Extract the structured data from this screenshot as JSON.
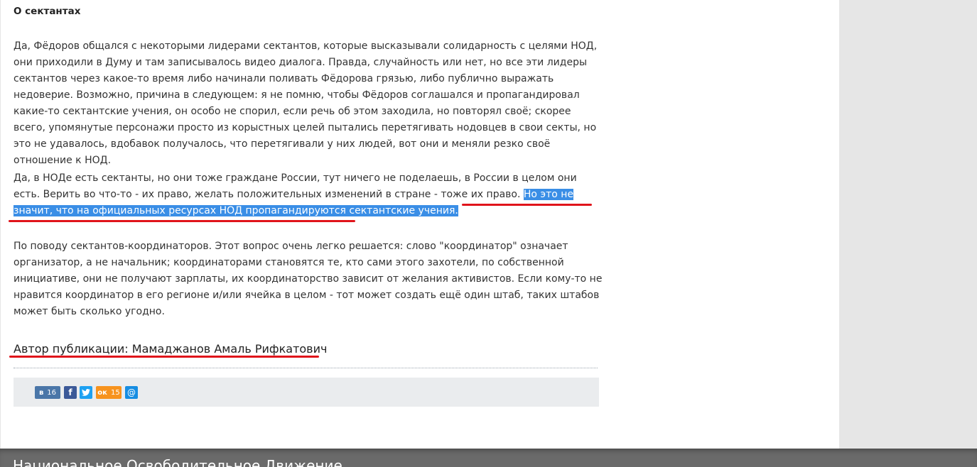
{
  "section_title": "О сектантах",
  "paragraphs": {
    "p1": "Да, Фёдоров общался с некоторыми лидерами сектантов, которые высказывали солидарность с целями НОД, они приходили в Думу и там записывалось видео диалога. Правда, случайность или нет, но все эти лидеры сектантов через какое-то время либо начинали поливать Фёдорова грязью, либо публично выражать недоверие. Возможно, причина в следующем: я не помню, чтобы Фёдоров соглашался и пропагандировал какие-то сектантские учения, он особо не спорил, если речь об этом заходила, но повторял своё; скорее всего, упомянутые персонажи просто из корыстных целей пытались перетягивать нодовцев в свои секты, но это не удавалось, вдобавок получалось, что перетягивали у них людей, вот они и меняли резко своё отношение к НОД.",
    "p2_normal": "Да, в НОДе есть сектанты, но они тоже граждане России, тут ничего не поделаешь, в России в целом они есть. Верить во что-то - их право, желать положительных изменений в стране - тоже их право. ",
    "p2_highlight": "Но это не значит, что на официальных ресурсах НОД пропагандируются сектантские учения.",
    "p3": "По поводу сектантов-координаторов. Этот вопрос очень легко решается: слово \"координатор\" означает организатор, а не начальник; координаторами становятся те, кто сами этого захотели, по собственной инициативе, они не получают зарплаты, их координаторство зависит от желания активистов. Если кому-то не нравится координатор в его регионе и/или ячейка в целом - тот может создать ещё один штаб, таких штабов может быть сколько угодно."
  },
  "author": "Автор публикации: Мамаджанов Амаль Рифкатович",
  "share": {
    "vk": {
      "icon": "в",
      "count": "16"
    },
    "fb": {
      "icon": "f"
    },
    "tw": {
      "icon": "🐦"
    },
    "ok": {
      "icon": "ок",
      "count": "15"
    },
    "mail": {
      "icon": "@"
    }
  },
  "footer_title": "Национальное Освободительное Движение",
  "colors": {
    "highlight": "#3a8ee6",
    "underline": "#e0141b",
    "footer": "#6a6a6a"
  }
}
